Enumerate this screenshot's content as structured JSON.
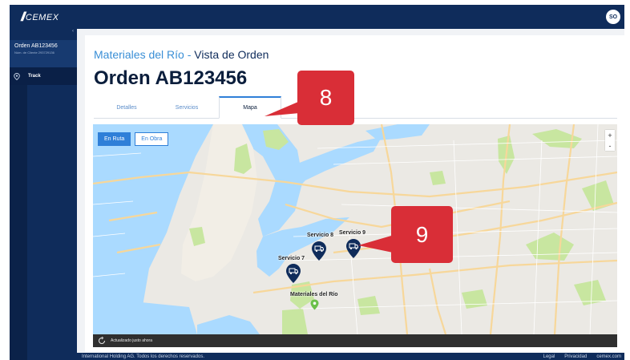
{
  "app": {
    "logo_text": "CEMEX",
    "avatar_initials": "SO"
  },
  "sidebar": {
    "order_title": "Orden AB123456",
    "order_sub": "Núm. de Cliente 293729136",
    "collapse_icon": "chevron-left-icon",
    "track_label": "Track",
    "track_icon": "location-pin-icon"
  },
  "header": {
    "client": "Materiales del Río",
    "separator": " - ",
    "view": "Vista de Orden",
    "title": "Orden AB123456"
  },
  "tabs": [
    {
      "label": "Detalles",
      "active": false
    },
    {
      "label": "Servicios",
      "active": false
    },
    {
      "label": "Mapa",
      "active": true
    }
  ],
  "map": {
    "buttons": {
      "en_ruta": "En Ruta",
      "en_obra": "En Obra"
    },
    "zoom_in": "+",
    "zoom_out": "-",
    "markers": [
      {
        "label": "Servicio 8"
      },
      {
        "label": "Servicio 9"
      },
      {
        "label": "Servicio 7"
      }
    ],
    "site_label": "Materiales del Río",
    "status_text": "Actualizado justo ahora"
  },
  "footer": {
    "copyright": "International Holding AG. Todos los derechos reservados.",
    "links": [
      "Legal",
      "Privacidad",
      "cemex.com"
    ]
  },
  "callouts": [
    "8",
    "9"
  ],
  "colors": {
    "navy": "#0f2c5b",
    "accent": "#2f7fd8",
    "callout": "#d92e37",
    "water": "#aadaff",
    "park": "#c8e6a0",
    "marker": "#0f2c5b"
  }
}
